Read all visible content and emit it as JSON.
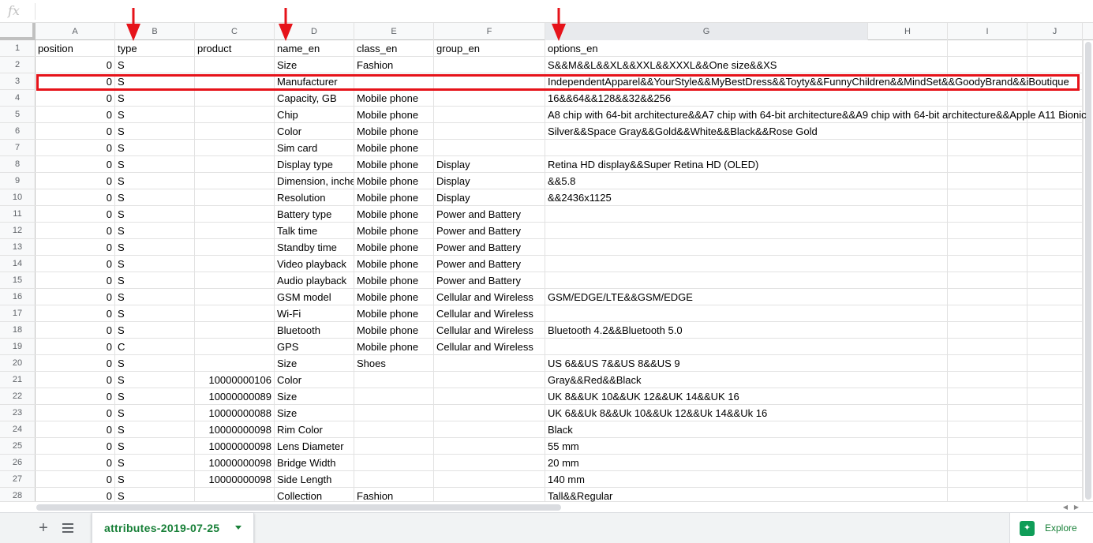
{
  "formula_bar": {
    "fx_label": "fx",
    "value": ""
  },
  "columns": [
    {
      "letter": "A"
    },
    {
      "letter": "B"
    },
    {
      "letter": "C"
    },
    {
      "letter": "D"
    },
    {
      "letter": "E"
    },
    {
      "letter": "F"
    },
    {
      "letter": "G"
    },
    {
      "letter": "H"
    },
    {
      "letter": "I"
    },
    {
      "letter": "J"
    }
  ],
  "rows": [
    {
      "n": "1",
      "a": "position",
      "b": "type",
      "c": "product",
      "d": "name_en",
      "e": "class_en",
      "f": "group_en",
      "g": "options_en"
    },
    {
      "n": "2",
      "a": "0",
      "b": "S",
      "c": "",
      "d": "Size",
      "e": "Fashion",
      "f": "",
      "g": "S&&M&&L&&XL&&XXL&&XXXL&&One size&&XS"
    },
    {
      "n": "3",
      "a": "0",
      "b": "S",
      "c": "",
      "d": "Manufacturer",
      "e": "",
      "f": "",
      "g": "IndependentApparel&&YourStyle&&MyBestDress&&Toyty&&FunnyChildren&&MindSet&&GoodyBrand&&iBoutique"
    },
    {
      "n": "4",
      "a": "0",
      "b": "S",
      "c": "",
      "d": "Capacity, GB",
      "e": "Mobile phone",
      "f": "",
      "g": "16&&64&&128&&32&&256"
    },
    {
      "n": "5",
      "a": "0",
      "b": "S",
      "c": "",
      "d": "Chip",
      "e": "Mobile phone",
      "f": "",
      "g": "A8 chip with 64‑bit architecture&&A7 chip with 64-bit architecture&&A9 chip with 64‑bit architecture&&Apple A11 Bionic"
    },
    {
      "n": "6",
      "a": "0",
      "b": "S",
      "c": "",
      "d": "Color",
      "e": "Mobile phone",
      "f": "",
      "g": "Silver&&Space Gray&&Gold&&White&&Black&&Rose Gold"
    },
    {
      "n": "7",
      "a": "0",
      "b": "S",
      "c": "",
      "d": "Sim card",
      "e": "Mobile phone",
      "f": "",
      "g": ""
    },
    {
      "n": "8",
      "a": "0",
      "b": "S",
      "c": "",
      "d": "Display type",
      "e": "Mobile phone",
      "f": "Display",
      "g": "Retina HD display&&Super Retina HD (OLED)"
    },
    {
      "n": "9",
      "a": "0",
      "b": "S",
      "c": "",
      "d": "Dimension, inche",
      "e": "Mobile phone",
      "f": "Display",
      "g": "&&5.8"
    },
    {
      "n": "10",
      "a": "0",
      "b": "S",
      "c": "",
      "d": "Resolution",
      "e": "Mobile phone",
      "f": "Display",
      "g": "&&2436x1125"
    },
    {
      "n": "11",
      "a": "0",
      "b": "S",
      "c": "",
      "d": "Battery type",
      "e": "Mobile phone",
      "f": "Power and Battery",
      "g": ""
    },
    {
      "n": "12",
      "a": "0",
      "b": "S",
      "c": "",
      "d": "Talk time",
      "e": "Mobile phone",
      "f": "Power and Battery",
      "g": ""
    },
    {
      "n": "13",
      "a": "0",
      "b": "S",
      "c": "",
      "d": "Standby time",
      "e": "Mobile phone",
      "f": "Power and Battery",
      "g": ""
    },
    {
      "n": "14",
      "a": "0",
      "b": "S",
      "c": "",
      "d": "Video playback",
      "e": "Mobile phone",
      "f": "Power and Battery",
      "g": ""
    },
    {
      "n": "15",
      "a": "0",
      "b": "S",
      "c": "",
      "d": "Audio playback",
      "e": "Mobile phone",
      "f": "Power and Battery",
      "g": ""
    },
    {
      "n": "16",
      "a": "0",
      "b": "S",
      "c": "",
      "d": "GSM model",
      "e": "Mobile phone",
      "f": "Cellular and Wireless",
      "g": "GSM/EDGE/LTE&&GSM/EDGE"
    },
    {
      "n": "17",
      "a": "0",
      "b": "S",
      "c": "",
      "d": "Wi-Fi",
      "e": "Mobile phone",
      "f": "Cellular and Wireless",
      "g": ""
    },
    {
      "n": "18",
      "a": "0",
      "b": "S",
      "c": "",
      "d": "Bluetooth",
      "e": "Mobile phone",
      "f": "Cellular and Wireless",
      "g": "Bluetooth 4.2&&Bluetooth 5.0"
    },
    {
      "n": "19",
      "a": "0",
      "b": "C",
      "c": "",
      "d": "GPS",
      "e": "Mobile phone",
      "f": "Cellular and Wireless",
      "g": ""
    },
    {
      "n": "20",
      "a": "0",
      "b": "S",
      "c": "",
      "d": "Size",
      "e": "Shoes",
      "f": "",
      "g": "US 6&&US 7&&US 8&&US 9"
    },
    {
      "n": "21",
      "a": "0",
      "b": "S",
      "c": "10000000106",
      "d": "Color",
      "e": "",
      "f": "",
      "g": "Gray&&Red&&Black"
    },
    {
      "n": "22",
      "a": "0",
      "b": "S",
      "c": "10000000089",
      "d": "Size",
      "e": "",
      "f": "",
      "g": "UK 8&&UK 10&&UK 12&&UK 14&&UK 16"
    },
    {
      "n": "23",
      "a": "0",
      "b": "S",
      "c": "10000000088",
      "d": "Size",
      "e": "",
      "f": "",
      "g": "UK 6&&Uk 8&&Uk 10&&Uk 12&&Uk 14&&Uk 16"
    },
    {
      "n": "24",
      "a": "0",
      "b": "S",
      "c": "10000000098",
      "d": "Rim Color",
      "e": "",
      "f": "",
      "g": "Black"
    },
    {
      "n": "25",
      "a": "0",
      "b": "S",
      "c": "10000000098",
      "d": "Lens Diameter",
      "e": "",
      "f": "",
      "g": "55 mm"
    },
    {
      "n": "26",
      "a": "0",
      "b": "S",
      "c": "10000000098",
      "d": "Bridge Width",
      "e": "",
      "f": "",
      "g": "20 mm"
    },
    {
      "n": "27",
      "a": "0",
      "b": "S",
      "c": "10000000098",
      "d": "Side Length",
      "e": "",
      "f": "",
      "g": "140 mm"
    },
    {
      "n": "28",
      "a": "0",
      "b": "S",
      "c": "",
      "d": "Collection",
      "e": "Fashion",
      "f": "",
      "g": "Tall&&Regular"
    }
  ],
  "sheet_tab": {
    "label": "attributes-2019-07-25"
  },
  "explore": {
    "label": "Explore"
  },
  "colors": {
    "highlight": "#e6131a",
    "accent": "#188038"
  }
}
